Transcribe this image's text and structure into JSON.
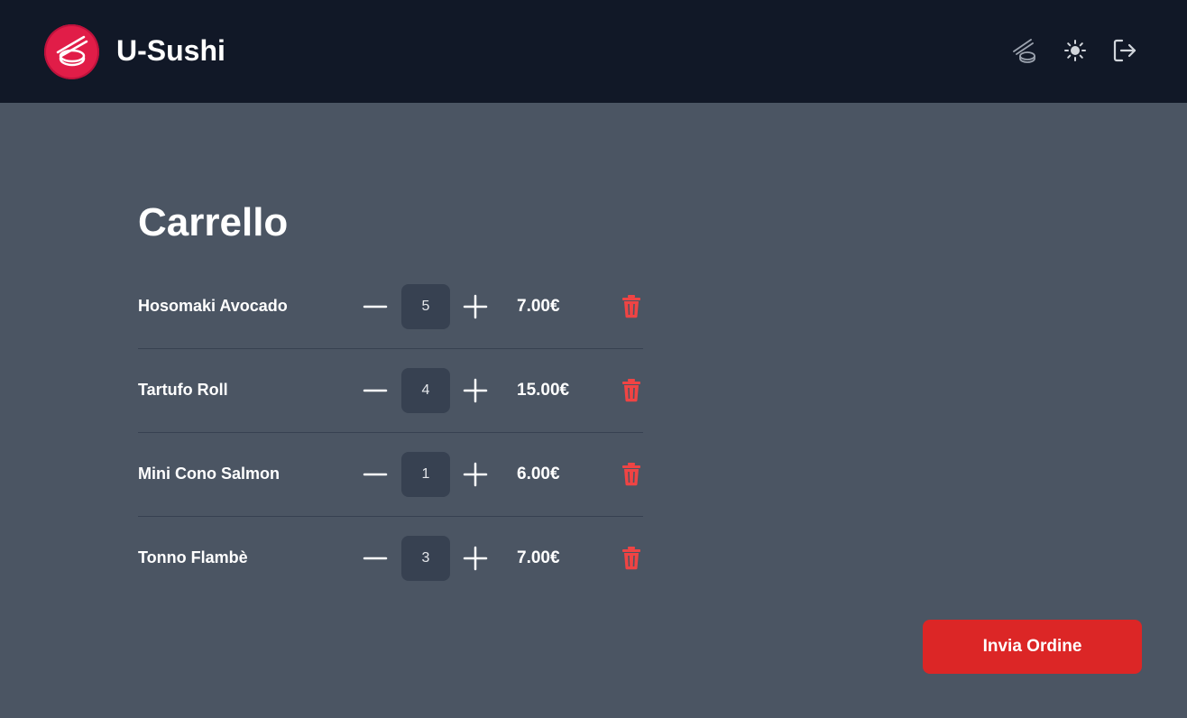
{
  "header": {
    "brand": "U-Sushi",
    "icons": [
      "sushi-logo-icon",
      "menu-chopsticks-icon",
      "theme-sun-icon",
      "logout-icon"
    ]
  },
  "cart": {
    "title": "Carrello",
    "items": [
      {
        "name": "Hosomaki Avocado",
        "quantity": "5",
        "price": "7.00€"
      },
      {
        "name": "Tartufo Roll",
        "quantity": "4",
        "price": "15.00€"
      },
      {
        "name": "Mini Cono Salmon",
        "quantity": "1",
        "price": "6.00€"
      },
      {
        "name": "Tonno Flambè",
        "quantity": "3",
        "price": "7.00€"
      }
    ]
  },
  "actions": {
    "send_label": "Invia Ordine"
  },
  "colors": {
    "topbar": "#111827",
    "background": "#4b5563",
    "accent": "#dc2626",
    "trash": "#ef4444",
    "logo": "#e11d48"
  }
}
